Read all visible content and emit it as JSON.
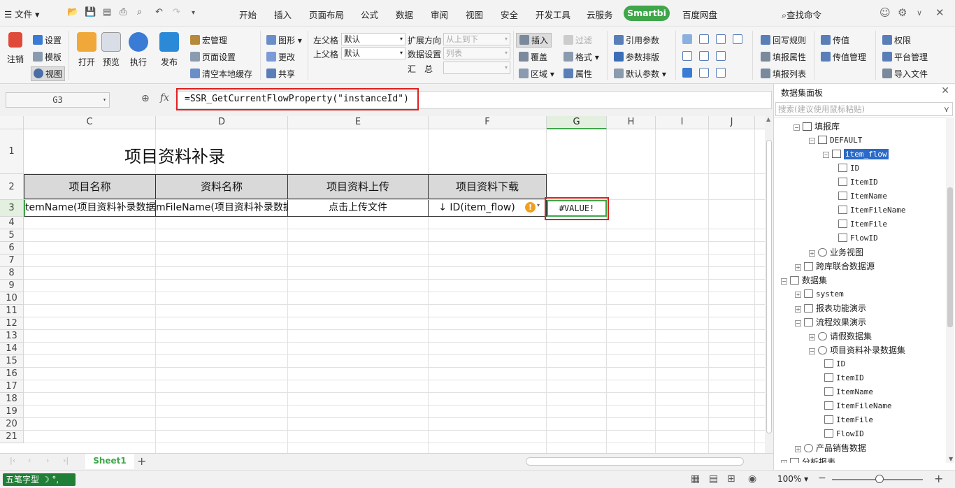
{
  "menubar": {
    "file_label": "文件",
    "tabs": [
      "开始",
      "插入",
      "页面布局",
      "公式",
      "数据",
      "审阅",
      "视图",
      "安全",
      "开发工具",
      "云服务"
    ],
    "active_tab": "Smartbi",
    "extra_tab": "百度网盘",
    "search_label": "查找命令"
  },
  "ribbon": {
    "logout": "注销",
    "settings": "设置",
    "template": "模板",
    "view": "视图",
    "open": "打开",
    "preview": "预览",
    "execute": "执行",
    "publish": "发布",
    "macro": "宏管理",
    "page_setup": "页面设置",
    "clear_cache": "清空本地缓存",
    "graphic": "图形",
    "change": "更改",
    "share": "共享",
    "left_parent": "左父格",
    "left_parent_value": "默认",
    "top_parent": "上父格",
    "top_parent_value": "默认",
    "expand_dir": "扩展方向",
    "expand_dir_value": "从上到下",
    "data_setting": "数据设置",
    "data_setting_value": "列表",
    "summary": "汇　总",
    "insert": "插入",
    "filter": "过滤",
    "cover": "覆盖",
    "format": "格式",
    "region": "区域",
    "property": "属性",
    "ref_param": "引用参数",
    "param_layout": "参数排版",
    "default_param": "默认参数",
    "writeback": "回写规则",
    "fill_prop": "填报属性",
    "fill_list": "填报列表",
    "pass_value": "传值",
    "pass_mgmt": "传值管理",
    "permission": "权限",
    "platform_mgmt": "平台管理",
    "import_file": "导入文件"
  },
  "formula_bar": {
    "cell_ref": "G3",
    "fx": "fx",
    "formula": "=SSR_GetCurrentFlowProperty(\"instanceId\")"
  },
  "grid": {
    "columns": [
      "C",
      "D",
      "E",
      "F",
      "G",
      "H",
      "I",
      "J"
    ],
    "rows": [
      "1",
      "2",
      "3",
      "4",
      "5",
      "6",
      "7",
      "8",
      "9",
      "10",
      "11",
      "12",
      "13",
      "14",
      "15",
      "16",
      "17",
      "18",
      "19",
      "20",
      "21"
    ],
    "title": "项目资料补录",
    "headers": [
      "项目名称",
      "资料名称",
      "项目资料上传",
      "项目资料下载"
    ],
    "row3": [
      "temName(项目资料补录数据",
      "mFileName(项目资料补录数据",
      "点击上传文件",
      "↓ ID(item_flow)"
    ],
    "g3_value": "#VALUE!"
  },
  "sheets": {
    "active": "Sheet1"
  },
  "status": {
    "ime": "五笔字型",
    "zoom": "100%"
  },
  "panel": {
    "title": "数据集面板",
    "search_placeholder": "搜索(建议使用鼠标粘贴)",
    "tree": [
      {
        "label": "填报库"
      },
      {
        "label": "DEFAULT"
      },
      {
        "label": "item_flow"
      },
      {
        "label": "ID"
      },
      {
        "label": "ItemID"
      },
      {
        "label": "ItemName"
      },
      {
        "label": "ItemFileName"
      },
      {
        "label": "ItemFile"
      },
      {
        "label": "FlowID"
      },
      {
        "label": "业务视图"
      },
      {
        "label": "跨库联合数据源"
      },
      {
        "label": "数据集"
      },
      {
        "label": "system"
      },
      {
        "label": "报表功能演示"
      },
      {
        "label": "流程效果演示"
      },
      {
        "label": "请假数据集"
      },
      {
        "label": "项目资料补录数据集"
      },
      {
        "label": "ID"
      },
      {
        "label": "ItemID"
      },
      {
        "label": "ItemName"
      },
      {
        "label": "ItemFileName"
      },
      {
        "label": "ItemFile"
      },
      {
        "label": "FlowID"
      },
      {
        "label": "产品销售数据"
      },
      {
        "label": "分析报表"
      }
    ]
  }
}
